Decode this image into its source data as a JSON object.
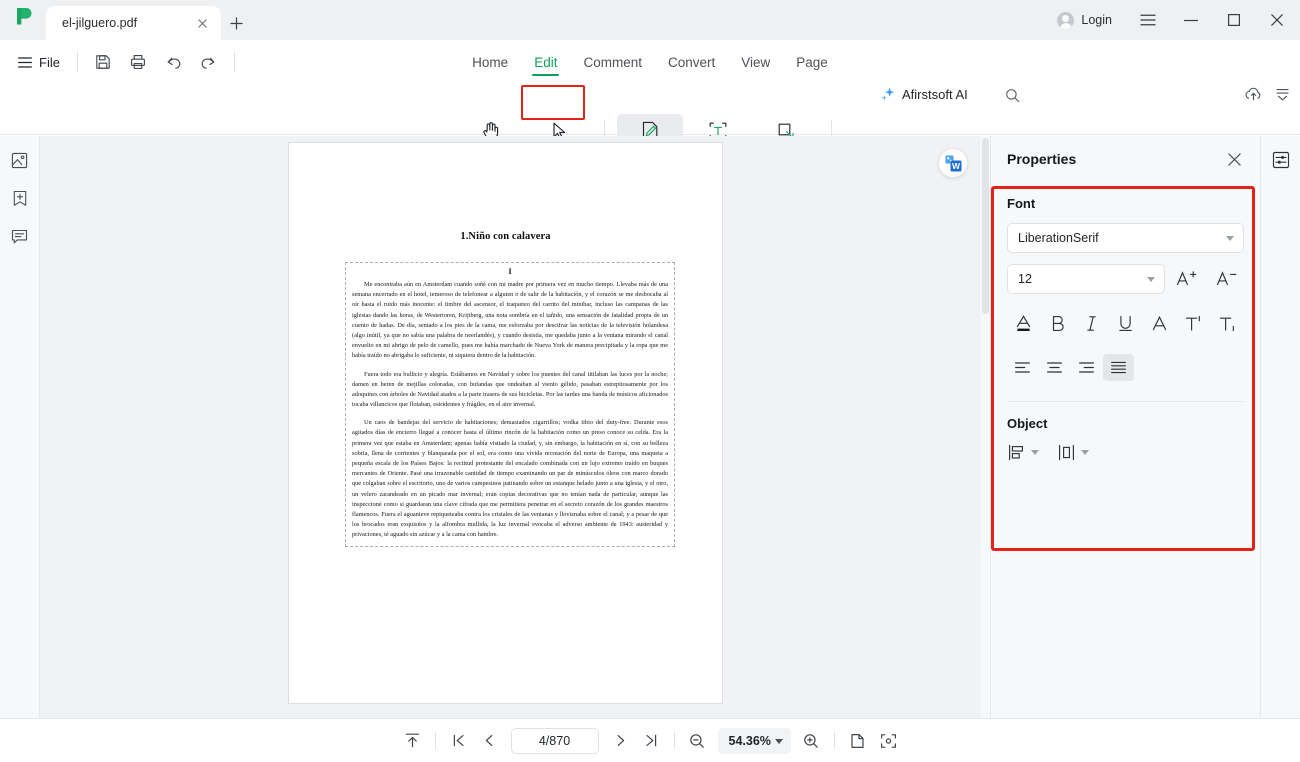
{
  "titlebar": {
    "logo_icon": "afirstsoft-logo-icon",
    "tab_title": "el-jilguero.pdf",
    "tab_close_icon": "close-icon",
    "new_tab_icon": "plus-icon",
    "login_label": "Login",
    "avatar_icon": "avatar-icon",
    "menu_icon": "hamburger-menu-icon",
    "minimize_icon": "minimize-icon",
    "maximize_icon": "maximize-icon",
    "close_icon": "close-icon"
  },
  "ribbon": {
    "file_label": "File",
    "file_menu_icon": "hamburger-icon",
    "quick_tools": [
      {
        "name": "save-icon",
        "label": "Save"
      },
      {
        "name": "print-icon",
        "label": "Print"
      },
      {
        "name": "undo-icon",
        "label": "Undo"
      },
      {
        "name": "redo-icon",
        "label": "Redo"
      }
    ],
    "tabs": [
      {
        "label": "Home",
        "active": false
      },
      {
        "label": "Edit",
        "active": true
      },
      {
        "label": "Comment",
        "active": false
      },
      {
        "label": "Convert",
        "active": false
      },
      {
        "label": "View",
        "active": false
      },
      {
        "label": "Page",
        "active": false
      }
    ],
    "active_tab_accent": "#12a05c",
    "annotation_box_color": "#e2231a",
    "ai_label": "Afirstsoft AI",
    "ai_icon": "sparkle-icon",
    "search_icon": "search-icon",
    "cloud_upload_icon": "cloud-upload-icon",
    "collapse_icon": "collapse-ribbon-icon",
    "tools": [
      {
        "label": "Hand",
        "icon": "hand-icon",
        "selected": false
      },
      {
        "label": "Select",
        "icon": "cursor-select-icon",
        "selected": false
      },
      {
        "label": "Edit",
        "icon": "edit-page-icon",
        "selected": true
      },
      {
        "label": "Add Text",
        "icon": "add-text-icon",
        "selected": false
      },
      {
        "label": "Crop Page",
        "icon": "crop-page-icon",
        "selected": false
      }
    ]
  },
  "left_rail": [
    {
      "name": "thumbnails-icon",
      "label": "Thumbnails"
    },
    {
      "name": "bookmark-add-icon",
      "label": "Bookmarks"
    },
    {
      "name": "comment-list-icon",
      "label": "Comments"
    }
  ],
  "right_rail": [
    {
      "name": "properties-panel-icon",
      "label": "Properties"
    }
  ],
  "document": {
    "word_convert_icon": "word-convert-icon",
    "title": "1.Niño con calavera",
    "section_number": "I",
    "paragraphs": [
      "Me encontraba aún en Amsterdam cuando soñé con mi madre por primera vez en mucho tiempo. Llevaba más de una semana encerrado en el hotel, temeroso de telefonear a alguien o de salir de la habitación, y el corazón se me desbocaba al oír hasta el ruido más inocente: el timbre del ascensor, el traqueteo del carrito del minibar, incluso las campanas de las iglesias dando las horas, de Westertoren, Krijtberg, una nota sombría en el tañido, una sensación de fatalidad propia de un cuento de hadas. De día, sentado a los pies de la cama, me esforzaba por descifrar las noticias de la televisión holandesa (algo inútil, ya que no sabía una palabra de neerlandés), y cuando desistía, me quedaba junto a la ventana mirando el canal envuelto en mi abrigo de pelo de camello, pues me había marchado de Nueva York de manera precipitada y la ropa que me había traído no abrigaba lo suficiente, ni siquiera dentro de la habitación.",
      "Fuera todo era bullicio y alegría. Estábamos en Navidad y sobre los puentes del canal titilaban las luces por la noche; damen en heren de mejillas coloradas, con bufandas que ondeaban al viento gélido, pasaban estrepitosamente por los adoquines con árboles de Navidad atados a la parte trasera de sus bicicletas. Por las tardes una banda de músicos aficionados tocaba villancicos que flotaban, estridentes y frágiles, en el aire invernal.",
      "Un caos de bandejas del servicio de habitaciones; demasiados cigarrillos; vodka tibio del duty-free. Durante esos agitados días de encierro llegué a conocer hasta el último rincón de la habitación como un preso conoce su celda. Era la primera vez que estaba en Amsterdam; apenas había visitado la ciudad, y, sin embargo, la habitación en sí, con su belleza sobria, llena de corrientes y blanqueada por el sol, era como una vívida recreación del norte de Europa, una maqueta a pequeña escala de los Países Bajos: la rectitud protestante del encalado combinada con un lujo extremo traído en buques mercantes de Oriente. Pasé una irrazonable cantidad de tiempo examinando un par de minúsculos óleos con marco dorado que colgaban sobre el escritorio, uno de varios campesinos patinando sobre un estanque helado junto a una iglesia, y el otro, un velero zarandeado en un picado mar invernal; eran copias decorativas que no tenían nada de particular, aunque las inspeccioné como si guardaran una clave cifrada que me permitiera penetrar en el secreto corazón de los grandes maestros flamencos. Fuera el aguanieve repiqueteaba contra los cristales de las ventanas y lloviznaba sobre el canal; y a pesar de que los brocados eran exquisitos y la alfombra mullida, la luz invernal evocaba el adverso ambiente de 1943: austeridad y privaciones, té aguado sin azúcar y a la cama con hambre."
    ]
  },
  "properties": {
    "title": "Properties",
    "close_icon": "close-icon",
    "annotation_box_color": "#e2231a",
    "font_section": {
      "title": "Font",
      "font_family_value": "LiberationSerif",
      "font_size_value": "12",
      "increase_size_icon": "increase-font-size-icon",
      "decrease_size_icon": "decrease-font-size-icon",
      "format_buttons": [
        {
          "name": "font-color-icon",
          "label": "Font Color",
          "active": false
        },
        {
          "name": "bold-icon",
          "label": "Bold",
          "active": false
        },
        {
          "name": "italic-icon",
          "label": "Italic",
          "active": false
        },
        {
          "name": "underline-icon",
          "label": "Underline",
          "active": false
        },
        {
          "name": "strikethrough-icon",
          "label": "Strikethrough",
          "active": false
        },
        {
          "name": "superscript-icon",
          "label": "Superscript",
          "active": false
        },
        {
          "name": "subscript-icon",
          "label": "Subscript",
          "active": false
        }
      ],
      "align_buttons": [
        {
          "name": "align-left-icon",
          "label": "Align Left",
          "active": false
        },
        {
          "name": "align-center-icon",
          "label": "Align Center",
          "active": false
        },
        {
          "name": "align-right-icon",
          "label": "Align Right",
          "active": false
        },
        {
          "name": "align-justify-icon",
          "label": "Justify",
          "active": true
        }
      ]
    },
    "object_section": {
      "title": "Object",
      "buttons": [
        {
          "name": "align-objects-icon",
          "label": "Align Objects"
        },
        {
          "name": "distribute-objects-icon",
          "label": "Distribute Objects"
        }
      ]
    }
  },
  "bottombar": {
    "scroll_top_icon": "scroll-to-top-icon",
    "first_page_icon": "first-page-icon",
    "prev_page_icon": "previous-page-icon",
    "page_value": "4/870",
    "next_page_icon": "next-page-icon",
    "last_page_icon": "last-page-icon",
    "zoom_out_icon": "zoom-out-icon",
    "zoom_value": "54.36%",
    "zoom_in_icon": "zoom-in-icon",
    "single_page_icon": "single-page-view-icon",
    "fit_page_icon": "fit-page-icon"
  }
}
